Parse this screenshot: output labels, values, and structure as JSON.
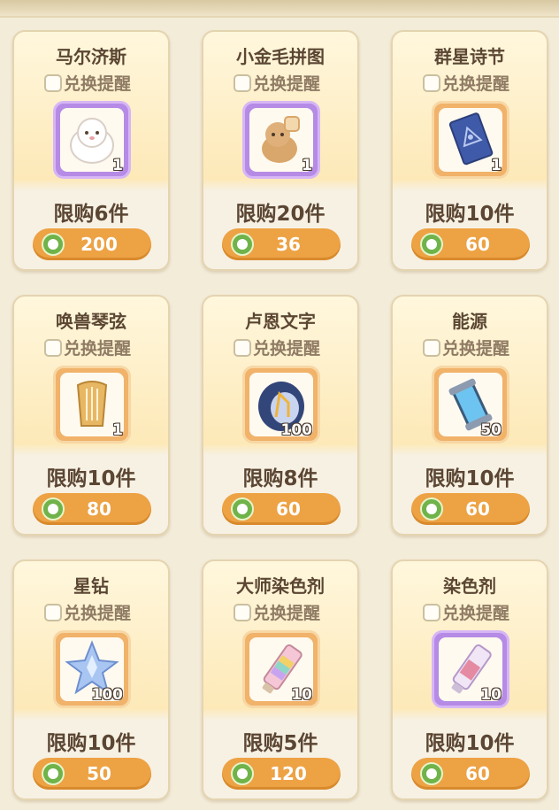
{
  "ui": {
    "remind_label": "兑换提醒"
  },
  "items": [
    {
      "name": "马尔济斯",
      "count": "1",
      "limit": "限购6件",
      "price": "200",
      "frame": "purple",
      "icon": "maltese-plush-icon"
    },
    {
      "name": "小金毛拼图",
      "count": "1",
      "limit": "限购20件",
      "price": "36",
      "frame": "purple",
      "icon": "golden-retriever-puzzle-icon"
    },
    {
      "name": "群星诗节",
      "count": "1",
      "limit": "限购10件",
      "price": "60",
      "frame": "orange",
      "icon": "star-poem-card-icon"
    },
    {
      "name": "唤兽琴弦",
      "count": "1",
      "limit": "限购10件",
      "price": "80",
      "frame": "orange",
      "icon": "harp-icon"
    },
    {
      "name": "卢恩文字",
      "count": "100",
      "limit": "限购8件",
      "price": "60",
      "frame": "orange",
      "icon": "rune-stone-icon"
    },
    {
      "name": "能源",
      "count": "50",
      "limit": "限购10件",
      "price": "60",
      "frame": "orange",
      "icon": "energy-canister-icon"
    },
    {
      "name": "星钻",
      "count": "100",
      "limit": "限购10件",
      "price": "50",
      "frame": "orange",
      "icon": "star-diamond-icon"
    },
    {
      "name": "大师染色剂",
      "count": "10",
      "limit": "限购5件",
      "price": "120",
      "frame": "orange",
      "icon": "master-dye-tube-icon"
    },
    {
      "name": "染色剂",
      "count": "10",
      "limit": "限购10件",
      "price": "60",
      "frame": "purple",
      "icon": "dye-tube-icon"
    }
  ],
  "currency_icon": "green-coin-icon",
  "colors": {
    "button": "#eda244",
    "purple_frame": "#b58be6",
    "orange_frame": "#f1b26a",
    "text": "#5b4633"
  }
}
